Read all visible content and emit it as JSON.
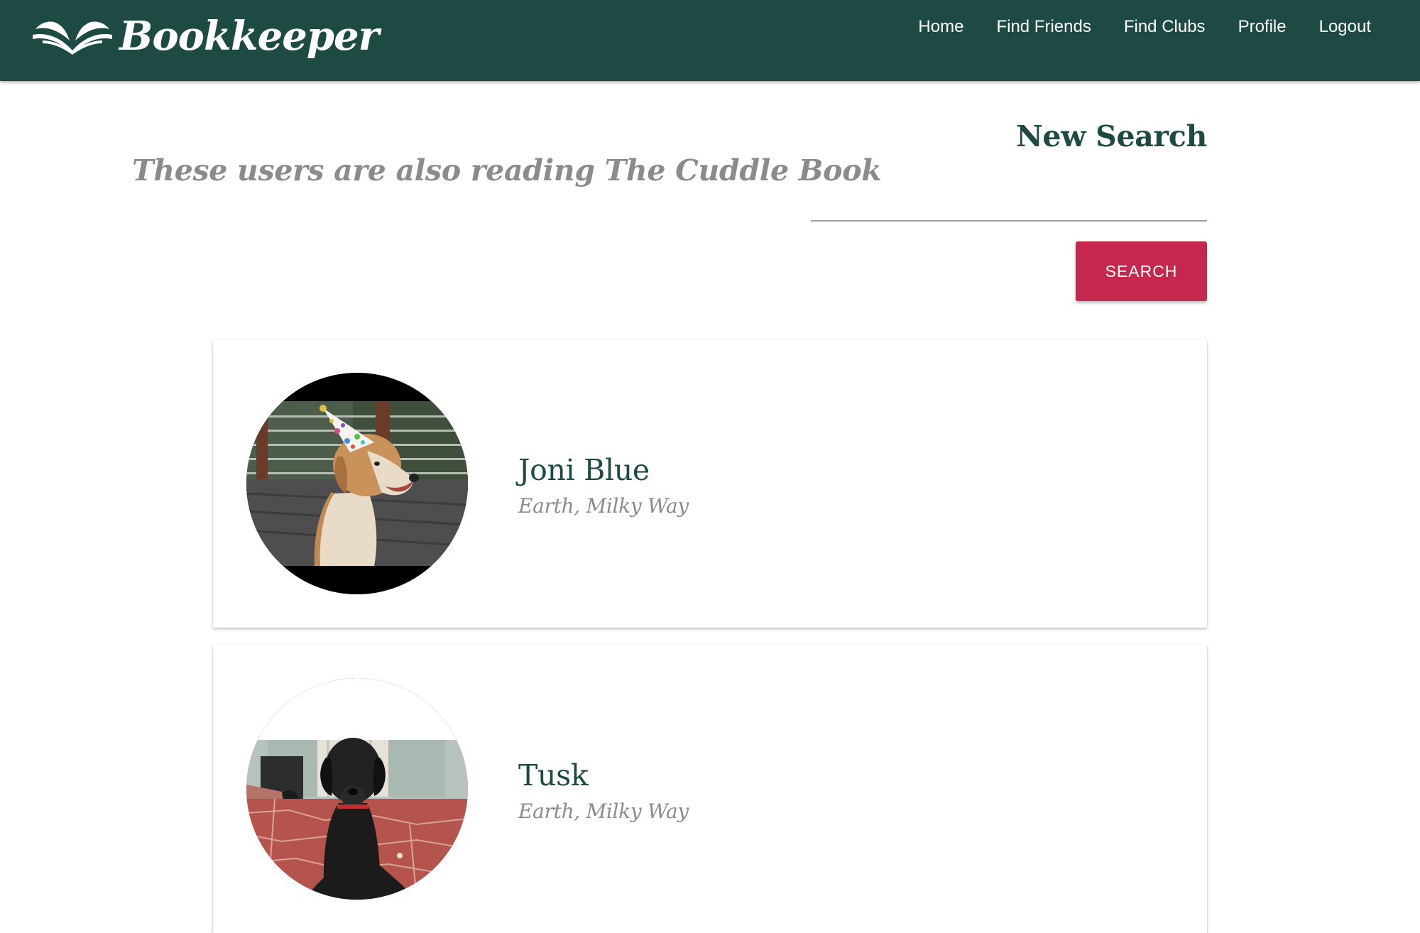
{
  "brand": {
    "name": "Bookkeeper",
    "icon": "open-book-icon"
  },
  "nav": {
    "items": [
      {
        "label": "Home"
      },
      {
        "label": "Find Friends"
      },
      {
        "label": "Find Clubs"
      },
      {
        "label": "Profile"
      },
      {
        "label": "Logout"
      }
    ]
  },
  "results": {
    "heading": "These users are also reading The Cuddle Book"
  },
  "search": {
    "title": "New Search",
    "value": "",
    "placeholder": "",
    "button_label": "SEARCH"
  },
  "users": [
    {
      "name": "Joni Blue",
      "location": "Earth, Milky Way",
      "avatar": "dog-party-hat-photo"
    },
    {
      "name": "Tusk",
      "location": "Earth, Milky Way",
      "avatar": "black-dog-patio-photo"
    }
  ],
  "colors": {
    "navbar": "#1e4a44",
    "accent": "#c5284c",
    "heading_green": "#1e4a44",
    "muted_text": "#8b8b8b"
  }
}
